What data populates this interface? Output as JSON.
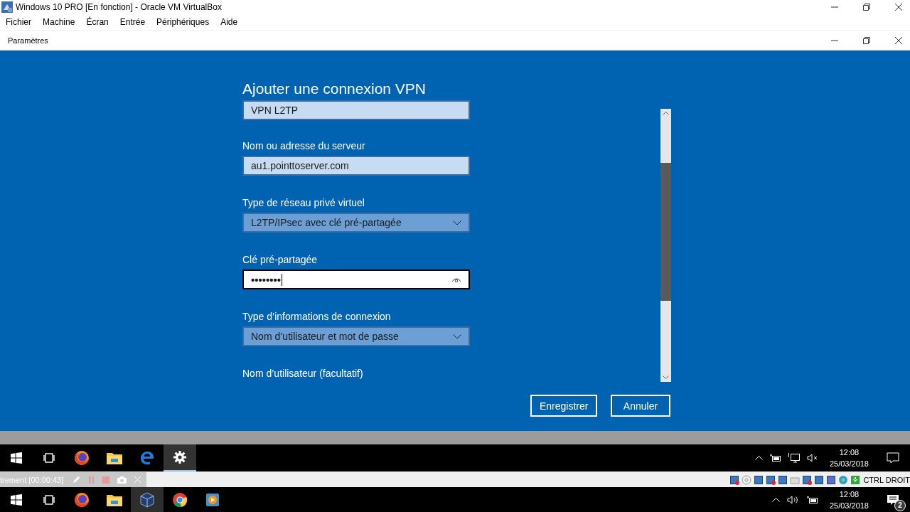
{
  "host_window": {
    "title": "Windows 10 PRO [En fonction] - Oracle VM VirtualBox"
  },
  "menu": [
    "Fichier",
    "Machine",
    "Écran",
    "Entrée",
    "Périphériques",
    "Aide"
  ],
  "settings_window": {
    "title": "Paramètres"
  },
  "dialog": {
    "heading": "Ajouter une connexion VPN",
    "fields": [
      {
        "kind": "text",
        "value": "VPN L2TP",
        "focused": false
      },
      {
        "kind": "text",
        "label": "Nom ou adresse du serveur",
        "value": "au1.pointtoserver.com",
        "focused": false
      },
      {
        "kind": "combo",
        "label": "Type de réseau privé virtuel",
        "value": "L2TP/IPsec avec clé pré-partagée",
        "focused": false
      },
      {
        "kind": "password",
        "label": "Clé pré-partagée",
        "value": "••••••••",
        "focused": true
      },
      {
        "kind": "combo",
        "label": "Type d’informations de connexion",
        "value": "Nom d’utilisateur et mot de passe",
        "focused": false
      },
      {
        "kind": "label",
        "label": "Nom d’utilisateur (facultatif)"
      }
    ],
    "buttons": [
      "Enregistrer",
      "Annuler"
    ]
  },
  "guest_taskbar": {
    "apps": [
      {
        "kind": "start",
        "selected": false
      },
      {
        "kind": "taskview",
        "selected": false
      },
      {
        "kind": "firefox",
        "selected": false
      },
      {
        "kind": "explorer",
        "selected": false
      },
      {
        "kind": "edge",
        "selected": false
      },
      {
        "kind": "settings",
        "selected": true
      }
    ],
    "time": "12:08",
    "date": "25/03/2018"
  },
  "vbox_status": {
    "recorder": "trement [00:00:43]",
    "host_key": "CTRL DROIT"
  },
  "host_taskbar": {
    "apps": [
      {
        "kind": "start",
        "selected": false
      },
      {
        "kind": "taskview",
        "selected": false
      },
      {
        "kind": "firefox",
        "selected": false
      },
      {
        "kind": "explorer",
        "selected": false
      },
      {
        "kind": "virtualbox",
        "selected": true
      },
      {
        "kind": "chrome",
        "selected": false
      },
      {
        "kind": "player",
        "selected": false
      }
    ],
    "time": "12:08",
    "date": "25/03/2018",
    "notifications": "2"
  }
}
